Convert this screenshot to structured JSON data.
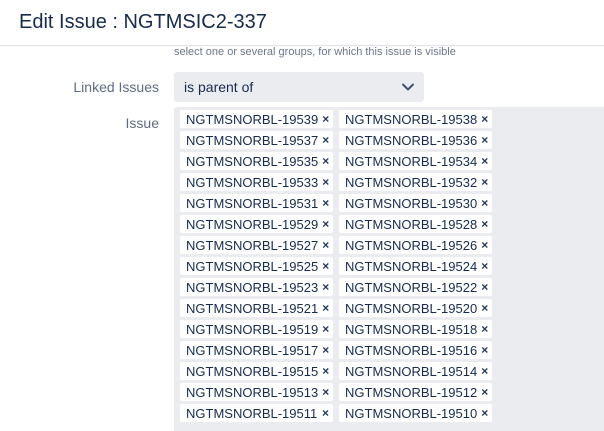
{
  "dialog": {
    "title": "Edit Issue : NGTMSIC2-337"
  },
  "security": {
    "help_text": "select one or several groups, for which this issue is visible"
  },
  "linked_issues": {
    "label": "Linked Issues",
    "selected": "is parent of"
  },
  "issue": {
    "label": "Issue",
    "tags": [
      "NGTMSNORBL-19539",
      "NGTMSNORBL-19538",
      "NGTMSNORBL-19537",
      "NGTMSNORBL-19536",
      "NGTMSNORBL-19535",
      "NGTMSNORBL-19534",
      "NGTMSNORBL-19533",
      "NGTMSNORBL-19532",
      "NGTMSNORBL-19531",
      "NGTMSNORBL-19530",
      "NGTMSNORBL-19529",
      "NGTMSNORBL-19528",
      "NGTMSNORBL-19527",
      "NGTMSNORBL-19526",
      "NGTMSNORBL-19525",
      "NGTMSNORBL-19524",
      "NGTMSNORBL-19523",
      "NGTMSNORBL-19522",
      "NGTMSNORBL-19521",
      "NGTMSNORBL-19520",
      "NGTMSNORBL-19519",
      "NGTMSNORBL-19518",
      "NGTMSNORBL-19517",
      "NGTMSNORBL-19516",
      "NGTMSNORBL-19515",
      "NGTMSNORBL-19514",
      "NGTMSNORBL-19513",
      "NGTMSNORBL-19512",
      "NGTMSNORBL-19511",
      "NGTMSNORBL-19510"
    ],
    "remove_glyph": "×"
  },
  "icons": {
    "dropdown": "chevron-down-icon",
    "remove": "close-icon"
  }
}
